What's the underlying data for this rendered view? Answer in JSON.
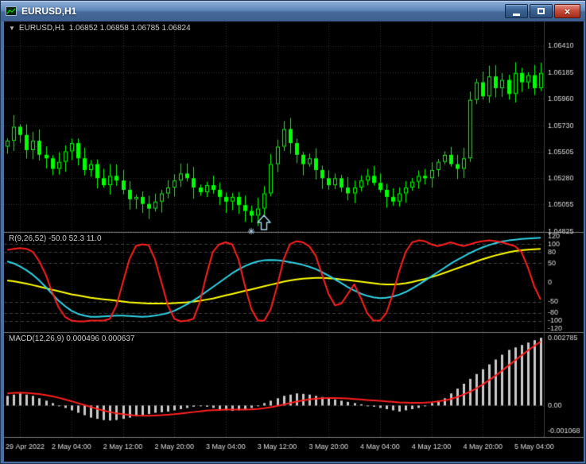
{
  "window": {
    "title": "EURUSD,H1"
  },
  "icons": {
    "dropdown": "▼",
    "close": "×",
    "chart_icon": "chart-line"
  },
  "price_pane": {
    "ohlc": "1.06852 1.06858 1.06785 1.06824"
  },
  "time_axis": {
    "labels": [
      "29 Apr 2022",
      "2 May 04:00",
      "2 May 12:00",
      "2 May 20:00",
      "3 May 04:00",
      "3 May 12:00",
      "3 May 20:00",
      "4 May 04:00",
      "4 May 12:00",
      "4 May 20:00",
      "5 May 04:00"
    ],
    "tick_bars": [
      2,
      10,
      18,
      26,
      34,
      42,
      50,
      58,
      66,
      74,
      82
    ]
  },
  "colors": {
    "background": "#000000",
    "grid": "#2e2e2e",
    "levels": "#3e3e3e",
    "separator": "#7a7a7a",
    "axis_text": "#dcdcdc",
    "candle": "#00ff00",
    "candle_bull_fill": "#000000",
    "macd_hist": "#c8c8c8",
    "macd_signal": "#ff1f1f",
    "annotation": "#a8d4e8"
  },
  "annotations": [
    {
      "type": "arrow-up",
      "bar": 40,
      "price": 1.0484
    },
    {
      "type": "star",
      "bar": 38,
      "price": 1.0483
    }
  ],
  "chart_data": [
    {
      "type": "candlestick",
      "pane": "price",
      "symbol": "EURUSD,H1",
      "ohlc_readout": "1.06852 1.06858 1.06785 1.06824",
      "ylim": [
        1.0482,
        1.0662
      ],
      "yticks": [
        1.0641,
        1.06185,
        1.0596,
        1.0573,
        1.05505,
        1.0528,
        1.05055,
        1.04825
      ],
      "ytick_labels": [
        "1.06410",
        "1.06185",
        "1.05960",
        "1.05730",
        "1.05505",
        "1.05280",
        "1.05055",
        "1.04825"
      ],
      "first_open": 1.0555,
      "closes": [
        1.056,
        1.0572,
        1.0565,
        1.0552,
        1.056,
        1.0548,
        1.0545,
        1.0536,
        1.0542,
        1.0551,
        1.0558,
        1.0545,
        1.0535,
        1.054,
        1.0528,
        1.0522,
        1.053,
        1.0526,
        1.0518,
        1.051,
        1.0512,
        1.0506,
        1.0502,
        1.0508,
        1.0515,
        1.052,
        1.0526,
        1.0532,
        1.0528,
        1.052,
        1.0516,
        1.0522,
        1.0518,
        1.0512,
        1.0508,
        1.0512,
        1.0505,
        1.05,
        1.0496,
        1.0502,
        1.0515,
        1.054,
        1.0555,
        1.057,
        1.0558,
        1.0548,
        1.054,
        1.0545,
        1.0535,
        1.0528,
        1.0522,
        1.0528,
        1.052,
        1.0515,
        1.052,
        1.0526,
        1.053,
        1.0524,
        1.0518,
        1.0512,
        1.0508,
        1.0515,
        1.052,
        1.0525,
        1.053,
        1.0528,
        1.0535,
        1.0542,
        1.0548,
        1.054,
        1.0536,
        1.0545,
        1.0595,
        1.061,
        1.0598,
        1.0615,
        1.0605,
        1.0612,
        1.06,
        1.0618,
        1.061,
        1.0616,
        1.0605,
        1.0618
      ]
    },
    {
      "type": "line",
      "pane": "oscillator",
      "label": "R(9,26,52) -50.0 52.3 11.0",
      "ylim": [
        -130,
        130
      ],
      "yticks": [
        120,
        100,
        80,
        50,
        0,
        -50,
        -80,
        -100,
        -120
      ],
      "ytick_labels": [
        "120",
        "100",
        "80",
        "50",
        "0",
        "-50",
        "-80",
        "-100",
        "-120"
      ],
      "level_lines": [
        100,
        80,
        50,
        -50,
        -80,
        -100
      ],
      "series": [
        {
          "name": "slow",
          "color": "#ffff00",
          "values": [
            5,
            3,
            0,
            -3,
            -7,
            -11,
            -15,
            -19,
            -23,
            -27,
            -31,
            -34,
            -37,
            -40,
            -42,
            -44,
            -46,
            -48,
            -50,
            -52,
            -53,
            -54,
            -55,
            -55,
            -55,
            -55,
            -54,
            -53,
            -52,
            -50,
            -48,
            -45,
            -42,
            -38,
            -34,
            -30,
            -26,
            -22,
            -18,
            -14,
            -10,
            -6,
            -2,
            2,
            5,
            8,
            10,
            11,
            12,
            12,
            11,
            10,
            8,
            6,
            4,
            2,
            0,
            -2,
            -4,
            -5,
            -5,
            -4,
            -2,
            1,
            5,
            9,
            14,
            19,
            25,
            31,
            37,
            43,
            49,
            55,
            61,
            66,
            71,
            75,
            79,
            82,
            84,
            86,
            87,
            88
          ]
        },
        {
          "name": "medium",
          "color": "#2fd3e6",
          "values": [
            55,
            50,
            42,
            32,
            20,
            5,
            -12,
            -30,
            -48,
            -62,
            -74,
            -82,
            -87,
            -90,
            -90,
            -89,
            -88,
            -87,
            -87,
            -88,
            -89,
            -90,
            -89,
            -87,
            -84,
            -80,
            -74,
            -66,
            -57,
            -47,
            -36,
            -24,
            -12,
            0,
            12,
            24,
            34,
            43,
            50,
            55,
            58,
            59,
            58,
            56,
            53,
            50,
            46,
            41,
            35,
            27,
            18,
            8,
            -2,
            -12,
            -21,
            -29,
            -35,
            -39,
            -41,
            -40,
            -37,
            -32,
            -25,
            -16,
            -6,
            5,
            16,
            27,
            38,
            49,
            59,
            68,
            77,
            85,
            92,
            98,
            103,
            107,
            110,
            112,
            114,
            115,
            116,
            117
          ]
        },
        {
          "name": "fast",
          "color": "#ff1f1f",
          "values": [
            85,
            88,
            90,
            88,
            80,
            55,
            20,
            -25,
            -65,
            -90,
            -100,
            -102,
            -102,
            -100,
            -100,
            -100,
            -95,
            -60,
            0,
            60,
            95,
            100,
            98,
            60,
            0,
            -60,
            -95,
            -102,
            -100,
            -95,
            -50,
            20,
            80,
            100,
            105,
            100,
            60,
            -10,
            -70,
            -100,
            -100,
            -70,
            -10,
            60,
            100,
            108,
            105,
            95,
            70,
            20,
            -30,
            -60,
            -55,
            -30,
            -5,
            -40,
            -80,
            -100,
            -100,
            -80,
            -30,
            30,
            80,
            105,
            110,
            108,
            100,
            95,
            100,
            105,
            100,
            95,
            100,
            105,
            108,
            110,
            108,
            105,
            100,
            95,
            80,
            40,
            -10,
            -45
          ]
        }
      ]
    },
    {
      "type": "macd",
      "pane": "macd",
      "label": "MACD(12,26,9) 0.000496 0.000637",
      "ylim": [
        -0.0013,
        0.003
      ],
      "yticks": [
        0.002785,
        0,
        -0.001068
      ],
      "ytick_labels": [
        "0.002785",
        "0.00",
        "-0.001068"
      ],
      "histogram": [
        0.0004,
        0.00045,
        0.0005,
        0.00045,
        0.0004,
        0.0003,
        0.0002,
        0.0001,
        0,
        -0.0001,
        -0.0002,
        -0.0003,
        -0.0004,
        -0.0005,
        -0.00055,
        -0.0006,
        -0.00062,
        -0.0006,
        -0.00055,
        -0.0005,
        -0.00045,
        -0.0004,
        -0.00035,
        -0.0003,
        -0.00028,
        -0.00025,
        -0.0002,
        -0.00015,
        -0.0001,
        -5e-05,
        0,
        -5e-05,
        -0.0001,
        -0.00015,
        -0.0002,
        -0.00022,
        -0.0002,
        -0.00015,
        -0.0001,
        0,
        0.0001,
        0.0002,
        0.0003,
        0.0004,
        0.00045,
        0.0005,
        0.00048,
        0.00045,
        0.0004,
        0.00035,
        0.0003,
        0.00025,
        0.0002,
        0.00015,
        0.0001,
        5e-05,
        0,
        -5e-05,
        -0.0001,
        -0.00015,
        -0.0002,
        -0.00025,
        -0.0002,
        -0.00015,
        -0.0001,
        0,
        0.0001,
        0.0002,
        0.0003,
        0.0005,
        0.0007,
        0.0009,
        0.0011,
        0.0013,
        0.0015,
        0.0017,
        0.0019,
        0.0021,
        0.0023,
        0.0024,
        0.0025,
        0.0026,
        0.0027,
        0.0028
      ],
      "signal": [
        0.0005,
        0.00052,
        0.00053,
        0.00052,
        0.0005,
        0.00047,
        0.00043,
        0.00038,
        0.00032,
        0.00025,
        0.00018,
        0.0001,
        2e-05,
        -6e-05,
        -0.00014,
        -0.00021,
        -0.00027,
        -0.00032,
        -0.00036,
        -0.00039,
        -0.00041,
        -0.00042,
        -0.00042,
        -0.00041,
        -0.0004,
        -0.00038,
        -0.00036,
        -0.00033,
        -0.0003,
        -0.00027,
        -0.00024,
        -0.00021,
        -0.00019,
        -0.00018,
        -0.00017,
        -0.00017,
        -0.00017,
        -0.00017,
        -0.00016,
        -0.00014,
        -0.00011,
        -7e-05,
        -2e-05,
        4e-05,
        0.0001,
        0.00016,
        0.00021,
        0.00025,
        0.00028,
        0.0003,
        0.00031,
        0.00031,
        0.0003,
        0.00029,
        0.00027,
        0.00025,
        0.00023,
        0.00021,
        0.00019,
        0.00017,
        0.00015,
        0.00013,
        0.00012,
        0.00011,
        0.00011,
        0.00012,
        0.00014,
        0.00017,
        0.00021,
        0.00027,
        0.00035,
        0.00045,
        0.00057,
        0.00071,
        0.00087,
        0.00105,
        0.00124,
        0.00144,
        0.00165,
        0.00186,
        0.00207,
        0.00227,
        0.00246,
        0.00264
      ]
    }
  ]
}
